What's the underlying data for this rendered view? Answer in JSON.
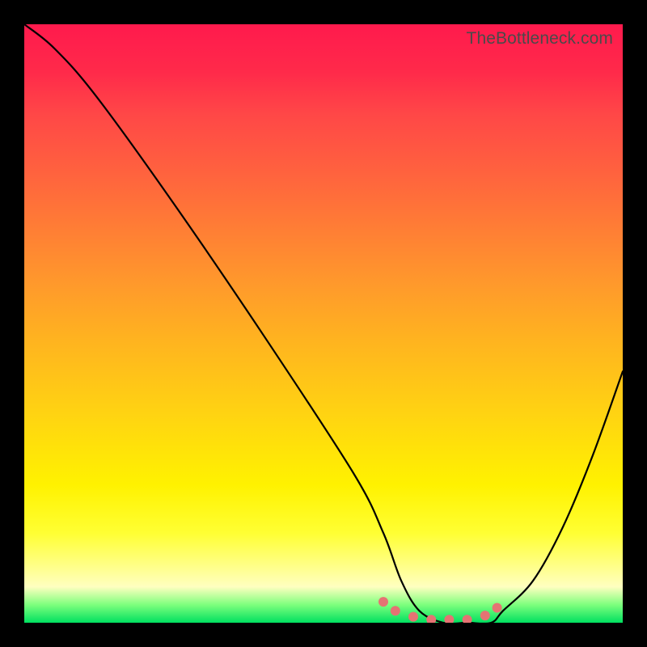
{
  "watermark": "TheBottleneck.com",
  "chart_data": {
    "type": "line",
    "title": "",
    "xlabel": "",
    "ylabel": "",
    "xlim": [
      0,
      100
    ],
    "ylim": [
      0,
      100
    ],
    "series": [
      {
        "name": "bottleneck-curve",
        "color": "#000000",
        "x": [
          0,
          5,
          12,
          25,
          40,
          55,
          60,
          63,
          66,
          70,
          74,
          78,
          80,
          85,
          90,
          95,
          100
        ],
        "y": [
          100,
          96,
          88,
          70,
          48,
          25,
          15,
          7,
          2,
          0,
          0,
          0,
          2,
          7,
          16,
          28,
          42
        ]
      }
    ],
    "markers": {
      "name": "optimal-range",
      "color": "#e57373",
      "radius": 6,
      "x": [
        60,
        62,
        65,
        68,
        71,
        74,
        77,
        79
      ],
      "y": [
        3.5,
        2,
        1,
        0.5,
        0.5,
        0.5,
        1.2,
        2.5
      ]
    }
  }
}
